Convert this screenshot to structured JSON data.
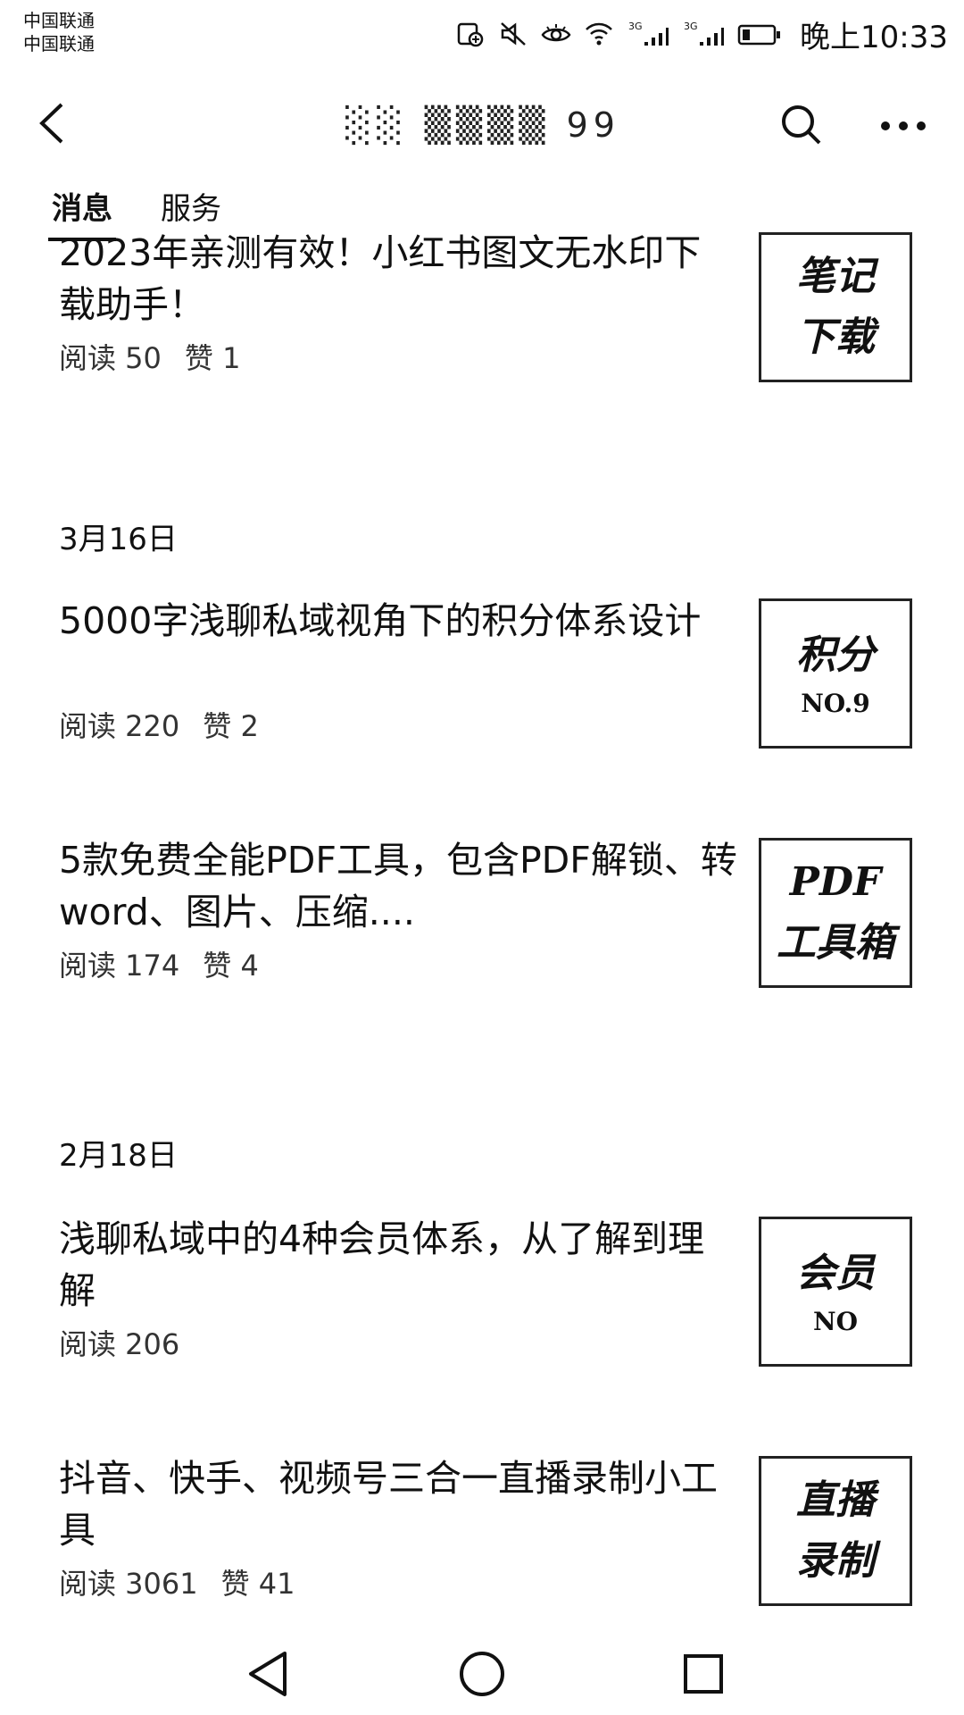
{
  "status_bar": {
    "carrier_1": "中国联通",
    "carrier_2": "中国联通",
    "signal_1_label": "3G",
    "signal_2_label": "3G",
    "time": "晚上10:33",
    "icons": [
      "nfc-icon",
      "mute-icon",
      "eye-comfort-icon",
      "wifi-icon",
      "signal-icon",
      "signal-icon",
      "battery-icon"
    ]
  },
  "header": {
    "title": "░░ ▒▒▒▒ 99",
    "back_icon": "back-arrow-icon",
    "search_icon": "search-icon",
    "more_icon": "more-icon"
  },
  "tabs": [
    {
      "label": "消息",
      "active": true
    },
    {
      "label": "服务",
      "active": false
    }
  ],
  "articles": [
    {
      "title": "2023年亲测有效！小红书图文无水印下载助手！",
      "reads": "阅读 50",
      "likes": "赞 1",
      "thumb": [
        "笔记",
        "下载"
      ]
    },
    {
      "title": "5000字浅聊私域视角下的积分体系设计",
      "reads": "阅读 220",
      "likes": "赞 2",
      "thumb": [
        "积分",
        "NO.9"
      ]
    },
    {
      "title": "5款免费全能PDF工具，包含PDF解锁、转word、图片、压缩....",
      "reads": "阅读 174",
      "likes": "赞 4",
      "thumb": [
        "PDF",
        "工具箱"
      ]
    },
    {
      "title": "浅聊私域中的4种会员体系，从了解到理解",
      "reads": "阅读 206",
      "likes": "",
      "thumb": [
        "会员",
        "NO"
      ]
    },
    {
      "title": "抖音、快手、视频号三合一直播录制小工具",
      "reads": "阅读 3061",
      "likes": "赞 41",
      "thumb": [
        "直播",
        "录制"
      ]
    }
  ],
  "dates": [
    "3月16日",
    "2月18日"
  ],
  "nav": {
    "back": "nav-back-icon",
    "home": "nav-home-icon",
    "recents": "nav-recents-icon"
  }
}
